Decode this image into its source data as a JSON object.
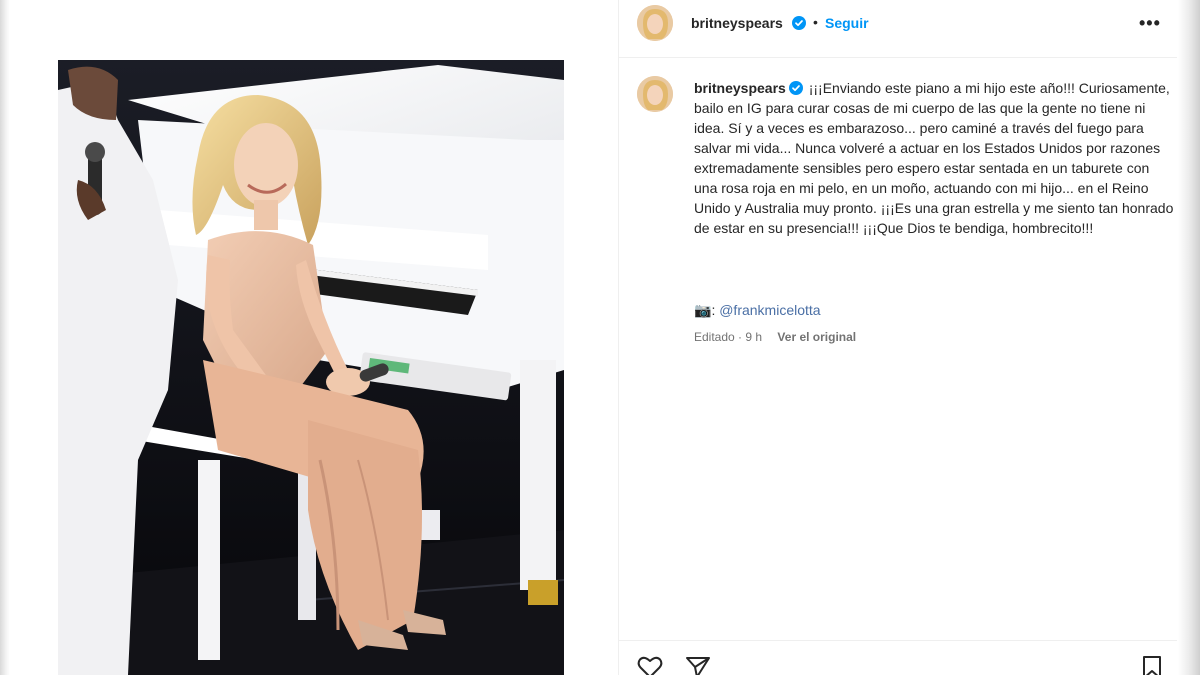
{
  "post": {
    "username": "britneyspears",
    "separator": "•",
    "follow_label": "Seguir",
    "more_label": "•••",
    "caption": {
      "username": "britneyspears",
      "text": "¡¡¡Enviando este piano a mi hijo este año!!! Curiosamente, bailo en IG para curar cosas de mi cuerpo de las que la gente no tiene ni idea. Sí y a veces es embarazoso... pero caminé a través del fuego para salvar mi vida... Nunca volveré a actuar en los Estados Unidos por razones extremadamente sensibles pero espero estar sentada en un taburete con una rosa roja en mi pelo, en un moño, actuando con mi hijo... en el Reino Unido y Australia muy pronto. ¡¡¡Es una gran estrella y me siento tan honrado de estar en su presencia!!! ¡¡¡Que Dios te bendiga, hombrecito!!!"
    },
    "camera_emoji": "📷",
    "camera_separator": ":",
    "mention": "@frankmicelotta",
    "edited_label": "Editado",
    "meta_separator": "·",
    "time_ago": "9 h",
    "see_original_label": "Ver el original"
  },
  "icons": {
    "verified": "verified-badge-icon",
    "heart": "heart-icon",
    "share": "share-icon",
    "save": "bookmark-icon",
    "more": "more-options-icon"
  },
  "colors": {
    "accent": "#0095f6",
    "verified": "#0095f6",
    "text": "#262626",
    "muted": "#737373"
  }
}
